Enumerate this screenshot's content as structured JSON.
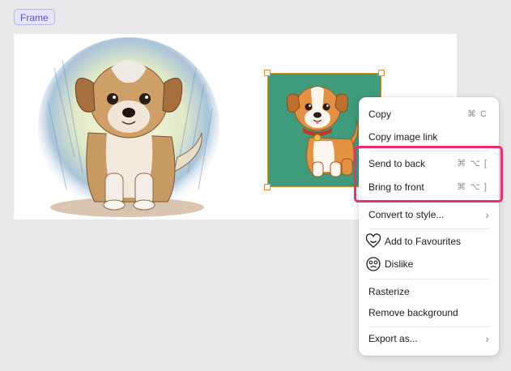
{
  "frame": {
    "label": "Frame"
  },
  "canvas": {
    "images": [
      {
        "name": "pencil-sketch-dog-image"
      },
      {
        "name": "cartoon-dog-image",
        "background": "#3e9b7b",
        "selected": true
      }
    ]
  },
  "context_menu": {
    "copy": {
      "label": "Copy",
      "shortcut": "⌘ C"
    },
    "copy_link": {
      "label": "Copy image link"
    },
    "send_back": {
      "label": "Send to back",
      "shortcut": "⌘ ⌥ ["
    },
    "bring_front": {
      "label": "Bring to front",
      "shortcut": "⌘ ⌥ ]"
    },
    "convert": {
      "label": "Convert to style...",
      "chevron": "›"
    },
    "favourites": {
      "label": "Add to Favourites",
      "icon": "heart-smile-icon"
    },
    "dislike": {
      "label": "Dislike",
      "icon": "sad-face-icon"
    },
    "rasterize": {
      "label": "Rasterize"
    },
    "remove_bg": {
      "label": "Remove background"
    },
    "export": {
      "label": "Export as...",
      "chevron": "›"
    }
  },
  "colors": {
    "highlight": "#ee2f6c",
    "selection": "#e58b2e",
    "frame_chip_text": "#5b4fd6"
  }
}
